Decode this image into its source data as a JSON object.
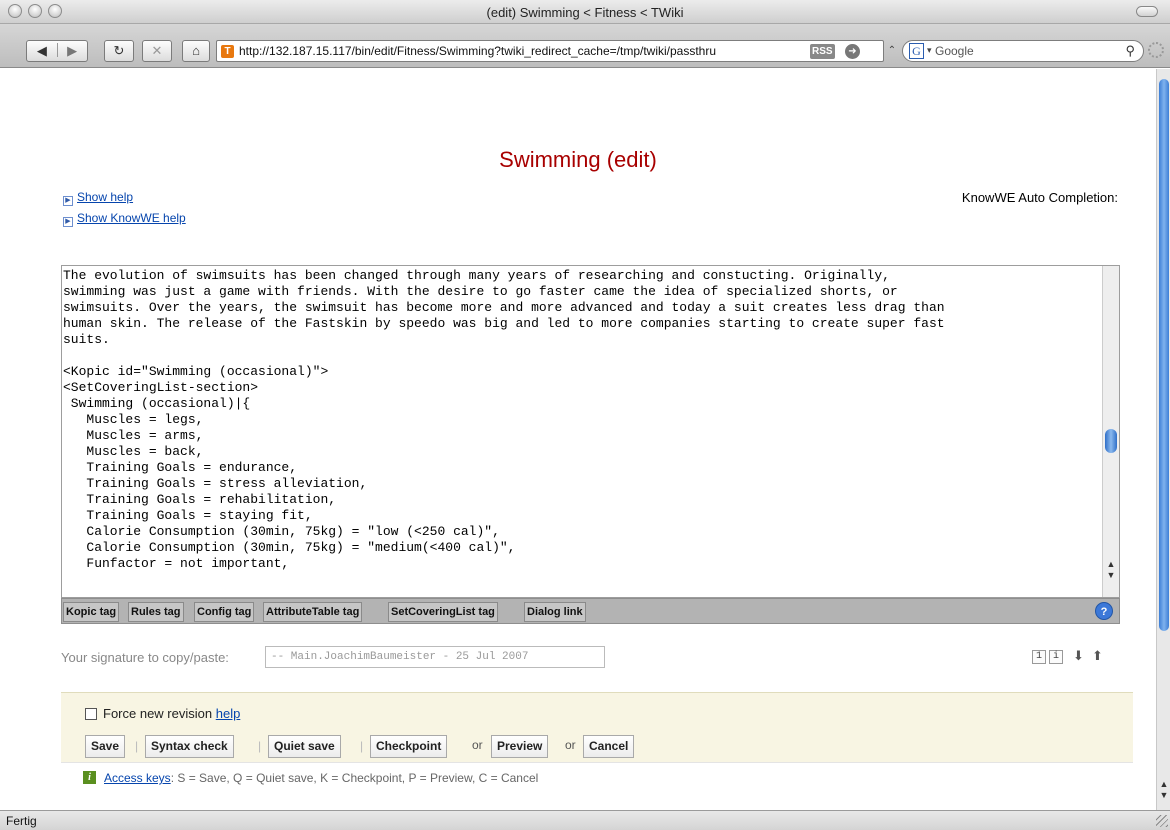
{
  "window": {
    "title": "(edit) Swimming < Fitness < TWiki",
    "url": "http://132.187.15.117/bin/edit/Fitness/Swimming?twiki_redirect_cache=/tmp/twiki/passthru",
    "rss_label": "RSS",
    "search_placeholder": "Google",
    "status": "Fertig"
  },
  "nav": {
    "back_icon": "back-arrow",
    "forward_icon": "forward-arrow",
    "reload_icon": "reload",
    "stop_icon": "stop-x",
    "home_icon": "home"
  },
  "page": {
    "title": "Swimming (edit)",
    "show_help": "Show help",
    "show_knowwe_help": "Show KnowWE help",
    "autocompletion_label": "KnowWE Auto Completion:"
  },
  "editor": {
    "lines": [
      "The evolution of swimsuits has been changed through many years of researching and constucting. Originally,",
      "swimming was just a game with friends. With the desire to go faster came the idea of specialized shorts, or",
      "swimsuits. Over the years, the swimsuit has become more and more advanced and today a suit creates less drag than",
      "human skin. The release of the Fastskin by speedo was big and led to more companies starting to create super fast",
      "suits.",
      "",
      "<Kopic id=\"Swimming (occasional)\">",
      "<SetCoveringList-section>",
      " Swimming (occasional)|{",
      "   Muscles = legs,",
      "   Muscles = arms,",
      "   Muscles = back,",
      "   Training Goals = endurance,",
      "   Training Goals = stress alleviation,",
      "   Training Goals = rehabilitation,",
      "   Training Goals = staying fit,",
      "   Calorie Consumption (30min, 75kg) = \"low (<250 cal)\",",
      "   Calorie Consumption (30min, 75kg) = \"medium(<400 cal)\",",
      "   Funfactor = not important,"
    ]
  },
  "tagbar": {
    "buttons": [
      "Kopic tag",
      "Rules tag",
      "Config tag",
      "AttributeTable tag",
      "SetCoveringList tag",
      "Dialog link"
    ],
    "help_label": "?"
  },
  "signature": {
    "label": "Your signature to copy/paste:",
    "value": "-- Main.JoachimBaumeister - 25 Jul 2007",
    "mini_1": "1",
    "mini_2": "i"
  },
  "save": {
    "force_revision": "Force new revision",
    "help_link": "help",
    "buttons": {
      "save": "Save",
      "syntax_check": "Syntax check",
      "quiet_save": "Quiet save",
      "checkpoint": "Checkpoint",
      "preview": "Preview",
      "cancel": "Cancel"
    },
    "or": "or"
  },
  "access": {
    "icon": "i",
    "link": "Access keys",
    "text": ": S = Save, Q = Quiet save, K = Checkpoint, P = Preview, C = Cancel"
  }
}
